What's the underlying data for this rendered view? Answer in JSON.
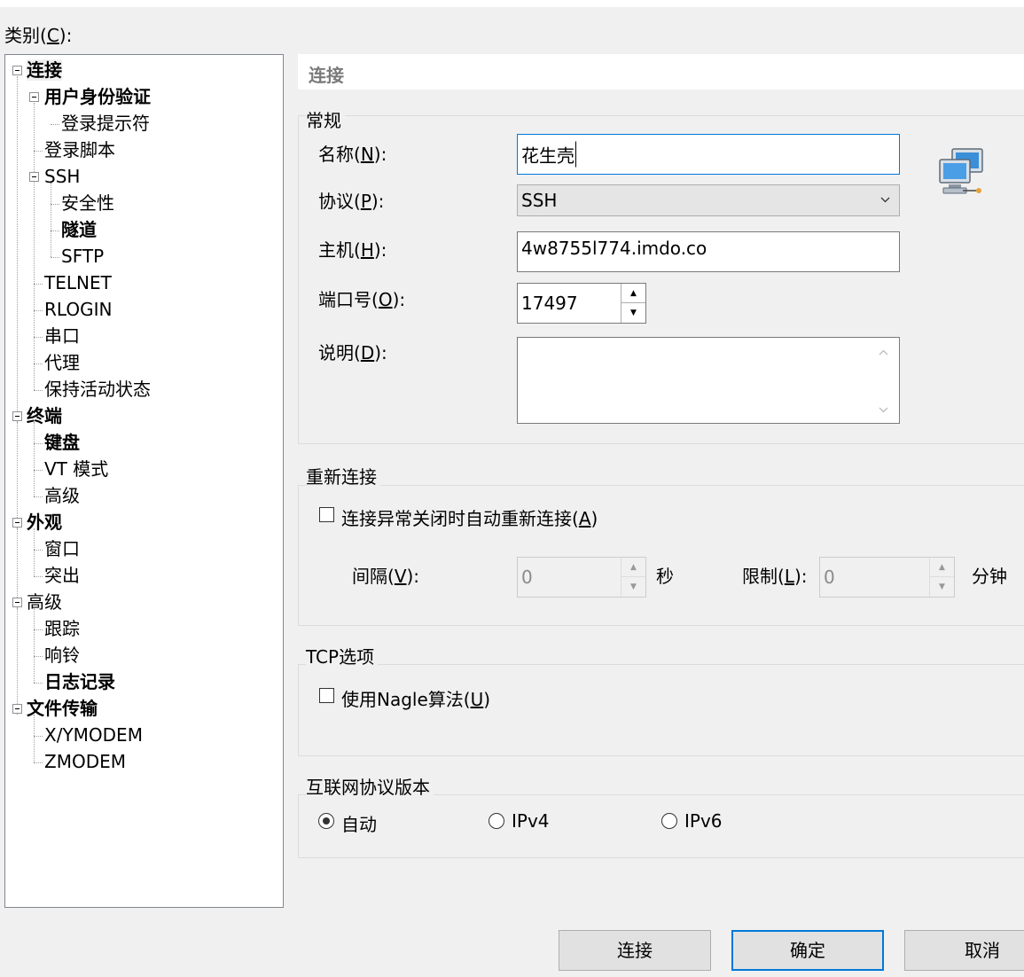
{
  "category": {
    "label_pre": "类别(",
    "label_key": "C",
    "label_post": "):"
  },
  "tree": {
    "connection": "连接",
    "auth": "用户身份验证",
    "login_prompt": "登录提示符",
    "login_script": "登录脚本",
    "ssh": "SSH",
    "security": "安全性",
    "tunnel": "隧道",
    "sftp": "SFTP",
    "telnet": "TELNET",
    "rlogin": "RLOGIN",
    "serial": "串口",
    "proxy": "代理",
    "keepalive": "保持活动状态",
    "terminal": "终端",
    "keyboard": "键盘",
    "vt_mode": "VT 模式",
    "advanced_term": "高级",
    "appearance": "外观",
    "window": "窗口",
    "highlight": "突出",
    "advanced": "高级",
    "trace": "跟踪",
    "bell": "响铃",
    "logging": "日志记录",
    "file_transfer": "文件传输",
    "xymodem": "X/YMODEM",
    "zmodem": "ZMODEM"
  },
  "panel": {
    "title": "连接"
  },
  "general": {
    "title": "常规",
    "name": {
      "pre": "名称(",
      "key": "N",
      "post": "):",
      "value": "花生壳"
    },
    "protocol": {
      "pre": "协议(",
      "key": "P",
      "post": "):",
      "value": "SSH"
    },
    "host": {
      "pre": "主机(",
      "key": "H",
      "post": "):",
      "value": "4w8755l774.imdo.co"
    },
    "port": {
      "pre": "端口号(",
      "key": "O",
      "post": "):",
      "value": "17497"
    },
    "desc": {
      "pre": "说明(",
      "key": "D",
      "post": "):",
      "value": ""
    }
  },
  "reconnect": {
    "title": "重新连接",
    "auto": {
      "pre": "连接异常关闭时自动重新连接(",
      "key": "A",
      "post": ")"
    },
    "interval": {
      "pre": "间隔(",
      "key": "V",
      "post": "):",
      "value": "0",
      "unit": "秒"
    },
    "limit": {
      "pre": "限制(",
      "key": "L",
      "post": "):",
      "value": "0",
      "unit": "分钟"
    }
  },
  "tcp": {
    "title": "TCP选项",
    "nagle": {
      "pre": "使用Nagle算法(",
      "key": "U",
      "post": ")"
    }
  },
  "ip": {
    "title": "互联网协议版本",
    "auto": "自动",
    "ipv4": "IPv4",
    "ipv6": "IPv6",
    "selected": "自动"
  },
  "buttons": {
    "connect": "连接",
    "ok": "确定",
    "cancel": "取消"
  },
  "colors": {
    "focus": "#0078d7",
    "monitor": "#3a8fd8"
  }
}
